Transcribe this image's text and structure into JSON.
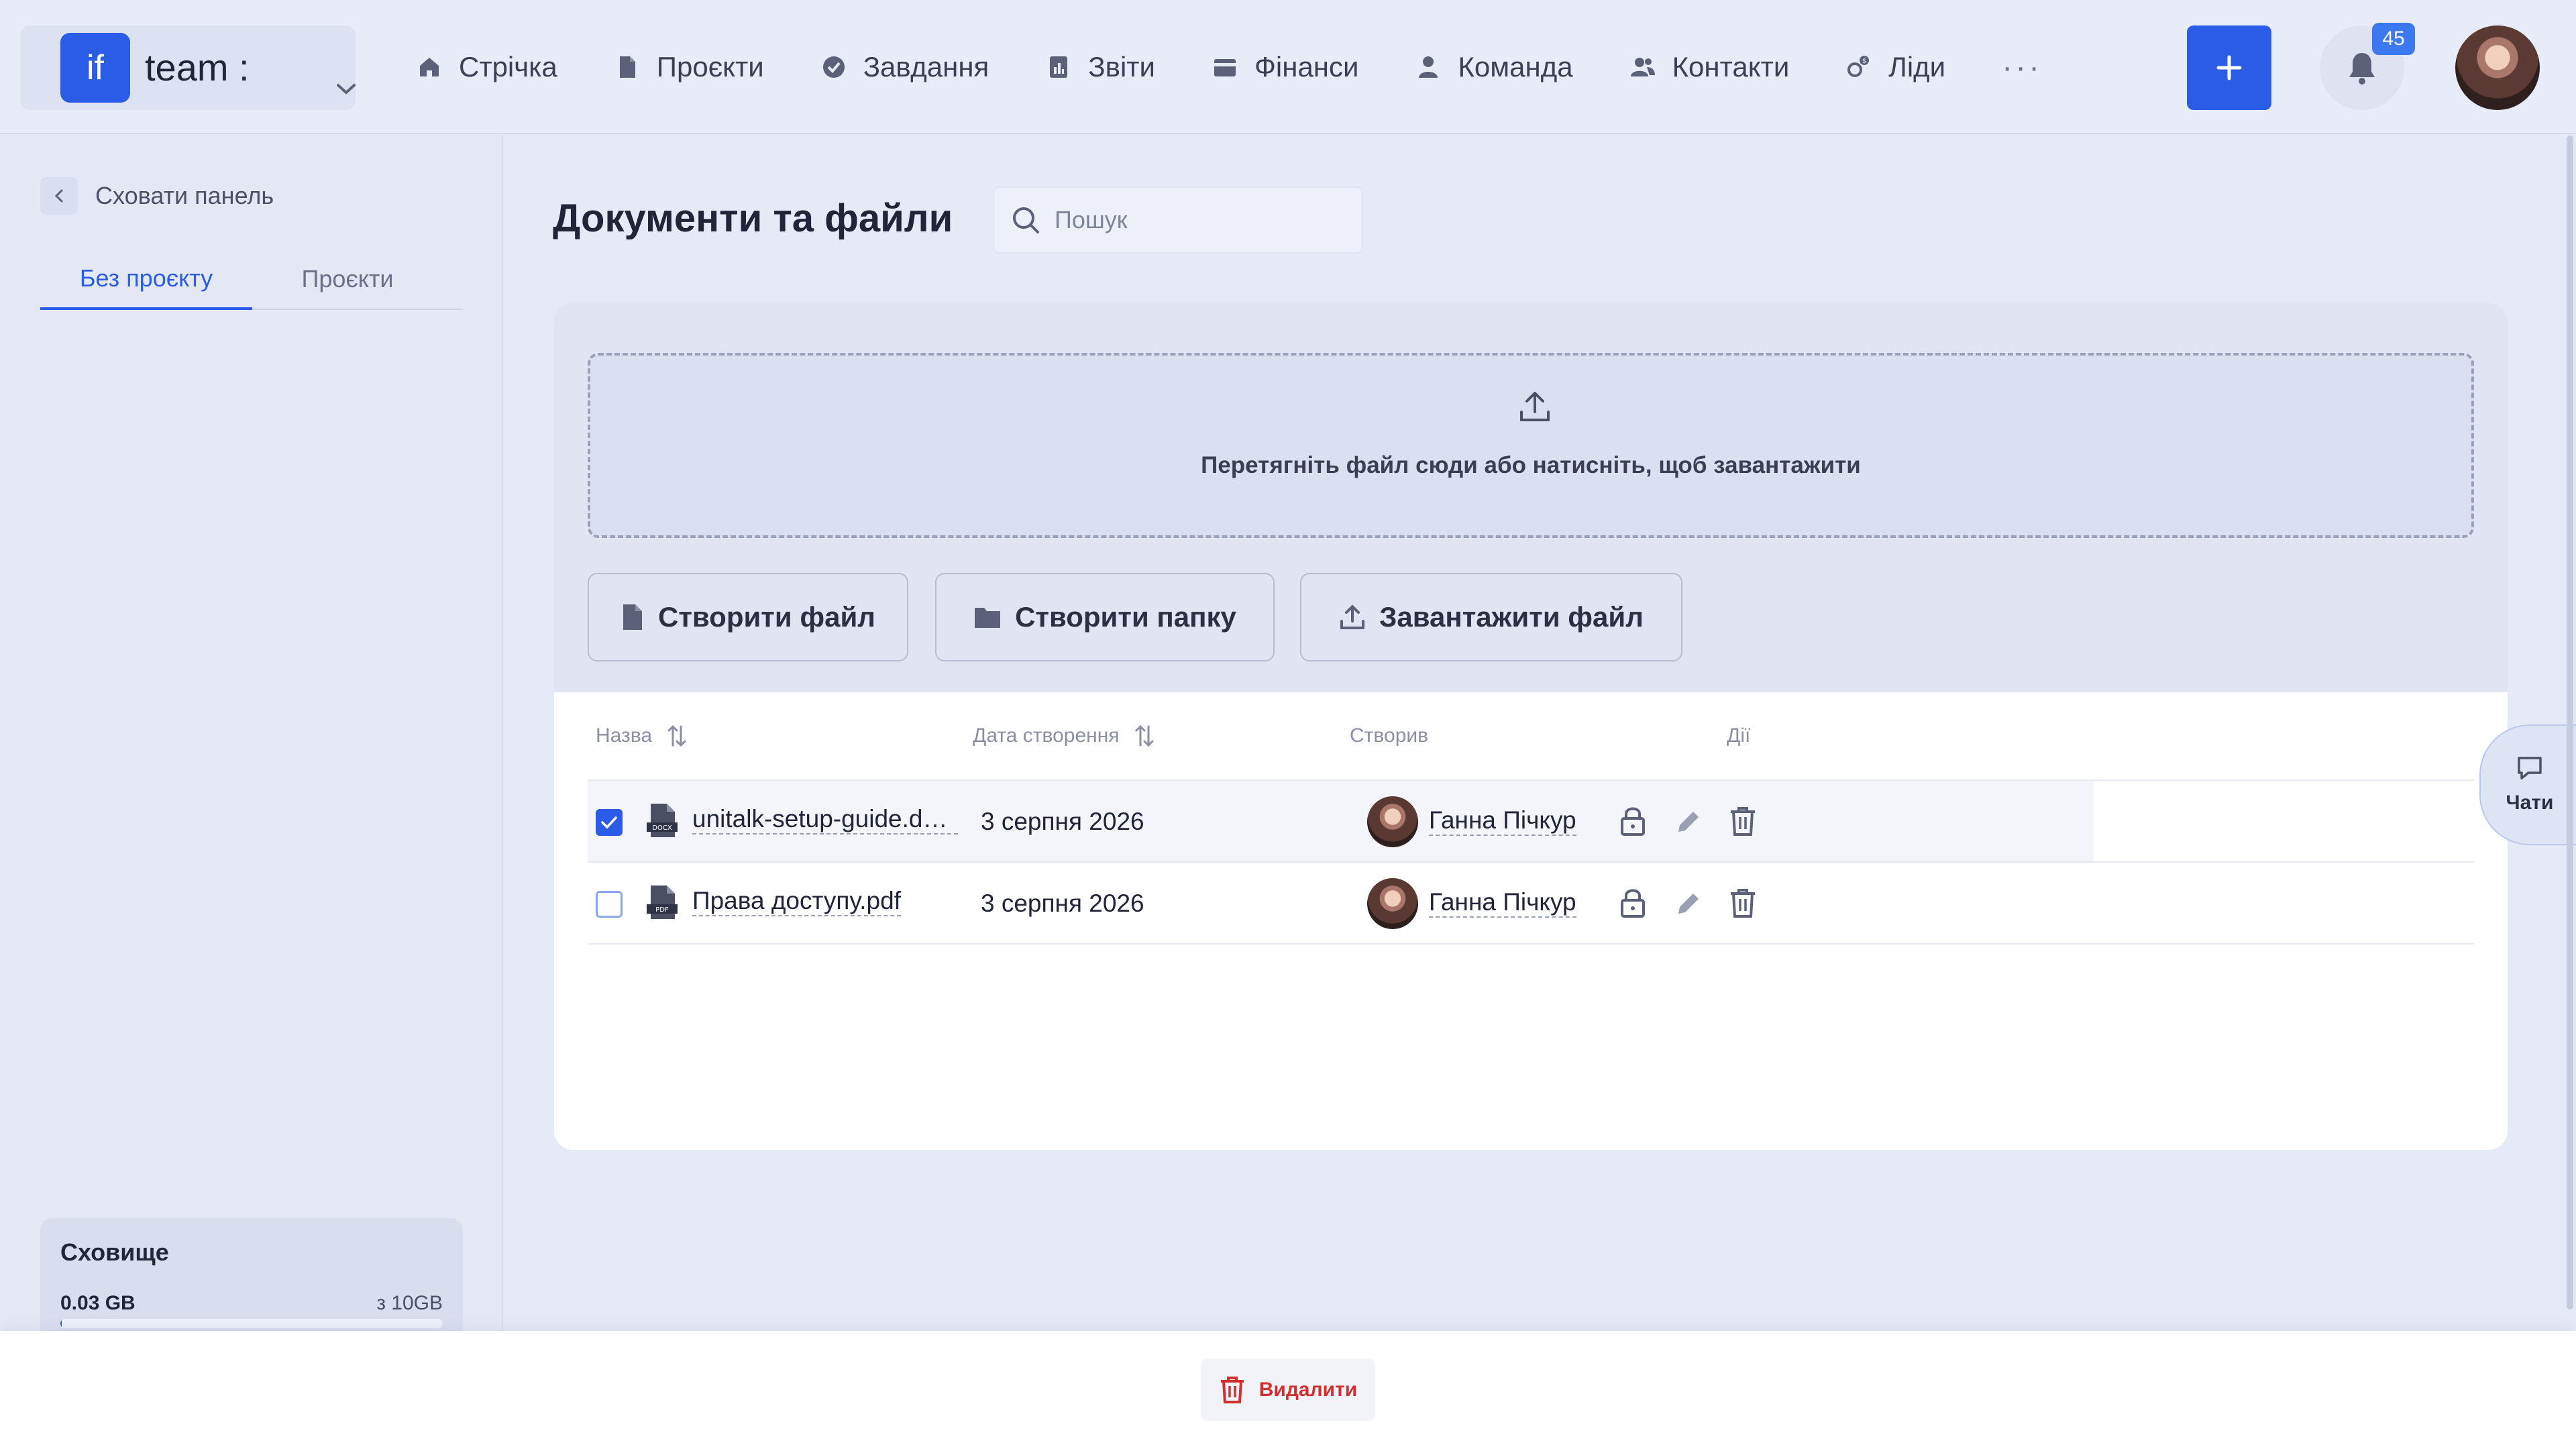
{
  "header": {
    "workspace": {
      "logo_text": "if",
      "name": "team :"
    },
    "nav": [
      {
        "label": "Стрічка",
        "icon": "home-icon"
      },
      {
        "label": "Проєкти",
        "icon": "document-icon"
      },
      {
        "label": "Завдання",
        "icon": "check-circle-icon"
      },
      {
        "label": "Звіти",
        "icon": "report-icon"
      },
      {
        "label": "Фінанси",
        "icon": "wallet-icon"
      },
      {
        "label": "Команда",
        "icon": "user-icon"
      },
      {
        "label": "Контакти",
        "icon": "contacts-icon"
      },
      {
        "label": "Ліди",
        "icon": "leads-icon"
      }
    ],
    "more": "···",
    "notifications_count": "45"
  },
  "sidebar": {
    "hide_label": "Сховати панель",
    "tabs": [
      {
        "label": "Без проєкту",
        "active": true
      },
      {
        "label": "Проєкти",
        "active": false
      }
    ],
    "storage": {
      "title": "Сховище",
      "used": "0.03 GB",
      "capacity": "з 10GB",
      "used_fraction": 0.003
    }
  },
  "main": {
    "title": "Документи та файли",
    "search_placeholder": "Пошук",
    "dropzone_text": "Перетягніть файл сюди або натисніть, щоб завантажити",
    "buttons": {
      "create_file": "Створити файл",
      "create_folder": "Створити папку",
      "upload_file": "Завантажити файл"
    },
    "table": {
      "columns": {
        "name": "Назва",
        "date": "Дата створення",
        "creator": "Створив",
        "actions": "Дії"
      },
      "rows": [
        {
          "name": "unitalk-setup-guide.docx",
          "file_type": "DOCX",
          "date": "3 серпня 2026",
          "creator": "Ганна Пічкур",
          "selected": true
        },
        {
          "name": "Права доступу.pdf",
          "file_type": "PDF",
          "date": "3 серпня 2026",
          "creator": "Ганна Пічкур",
          "selected": false
        }
      ]
    }
  },
  "chats_label": "Чати",
  "bottom_bar": {
    "delete_label": "Видалити"
  },
  "colors": {
    "accent": "#2a5ce8",
    "danger": "#d32f2f",
    "background": "#e6eaf7"
  }
}
